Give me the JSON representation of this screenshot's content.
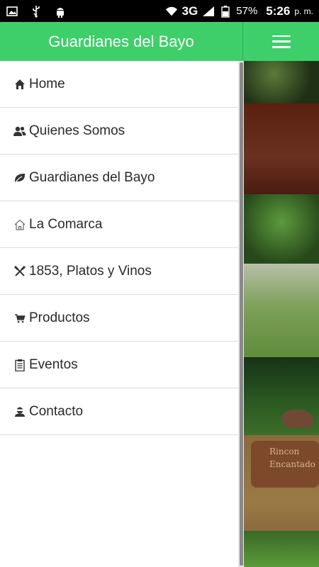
{
  "status_bar": {
    "network": "3G",
    "battery": "57%",
    "time": "5:26",
    "ampm": "p. m."
  },
  "app_bar": {
    "title": "Guardianes del Bayo"
  },
  "menu": {
    "items": [
      {
        "label": "Home",
        "icon": "home-icon"
      },
      {
        "label": "Quienes Somos",
        "icon": "users-icon"
      },
      {
        "label": "Guardianes del Bayo",
        "icon": "leaf-icon"
      },
      {
        "label": "La Comarca",
        "icon": "house-outline-icon"
      },
      {
        "label": "1853, Platos y Vinos",
        "icon": "cutlery-icon"
      },
      {
        "label": "Productos",
        "icon": "cart-icon"
      },
      {
        "label": "Eventos",
        "icon": "clipboard-icon"
      },
      {
        "label": "Contacto",
        "icon": "contact-icon"
      }
    ]
  },
  "background": {
    "sign_text": [
      "Rincon",
      "Encantado"
    ]
  },
  "colors": {
    "accent": "#3ecf6a",
    "text": "#2a2a2a",
    "divider": "#dcdcdc"
  }
}
